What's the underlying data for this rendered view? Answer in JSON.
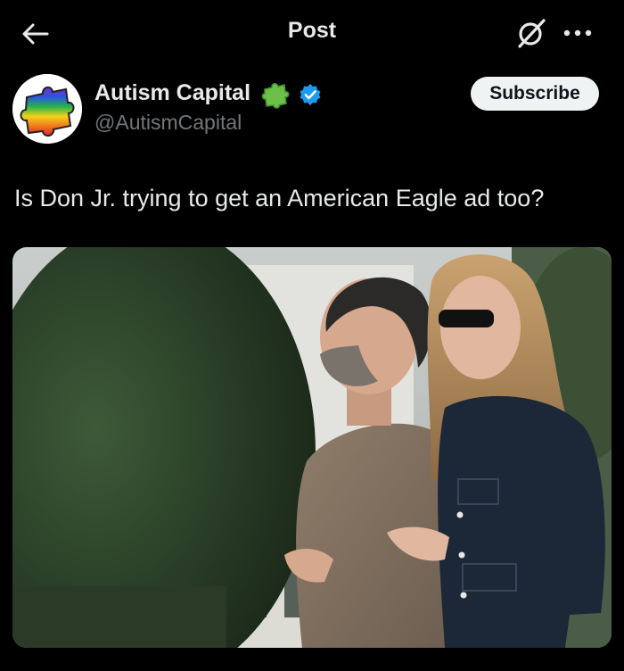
{
  "header": {
    "title": "Post",
    "back_icon": "arrow-left-icon",
    "grok_icon": "grok-icon",
    "more_icon": "more-horizontal-icon"
  },
  "author": {
    "name": "Autism Capital",
    "handle": "@AutismCapital",
    "badge_emoji_icon": "puzzle-piece-icon",
    "verified_icon": "verified-badge-icon",
    "verified_color": "#1d9bf0",
    "subscribe_label": "Subscribe"
  },
  "post": {
    "text": "Is Don Jr. trying to get an American Eagle ad too?"
  },
  "colors": {
    "background": "#000000",
    "text": "#e7e9ea",
    "secondary_text": "#71767b"
  }
}
